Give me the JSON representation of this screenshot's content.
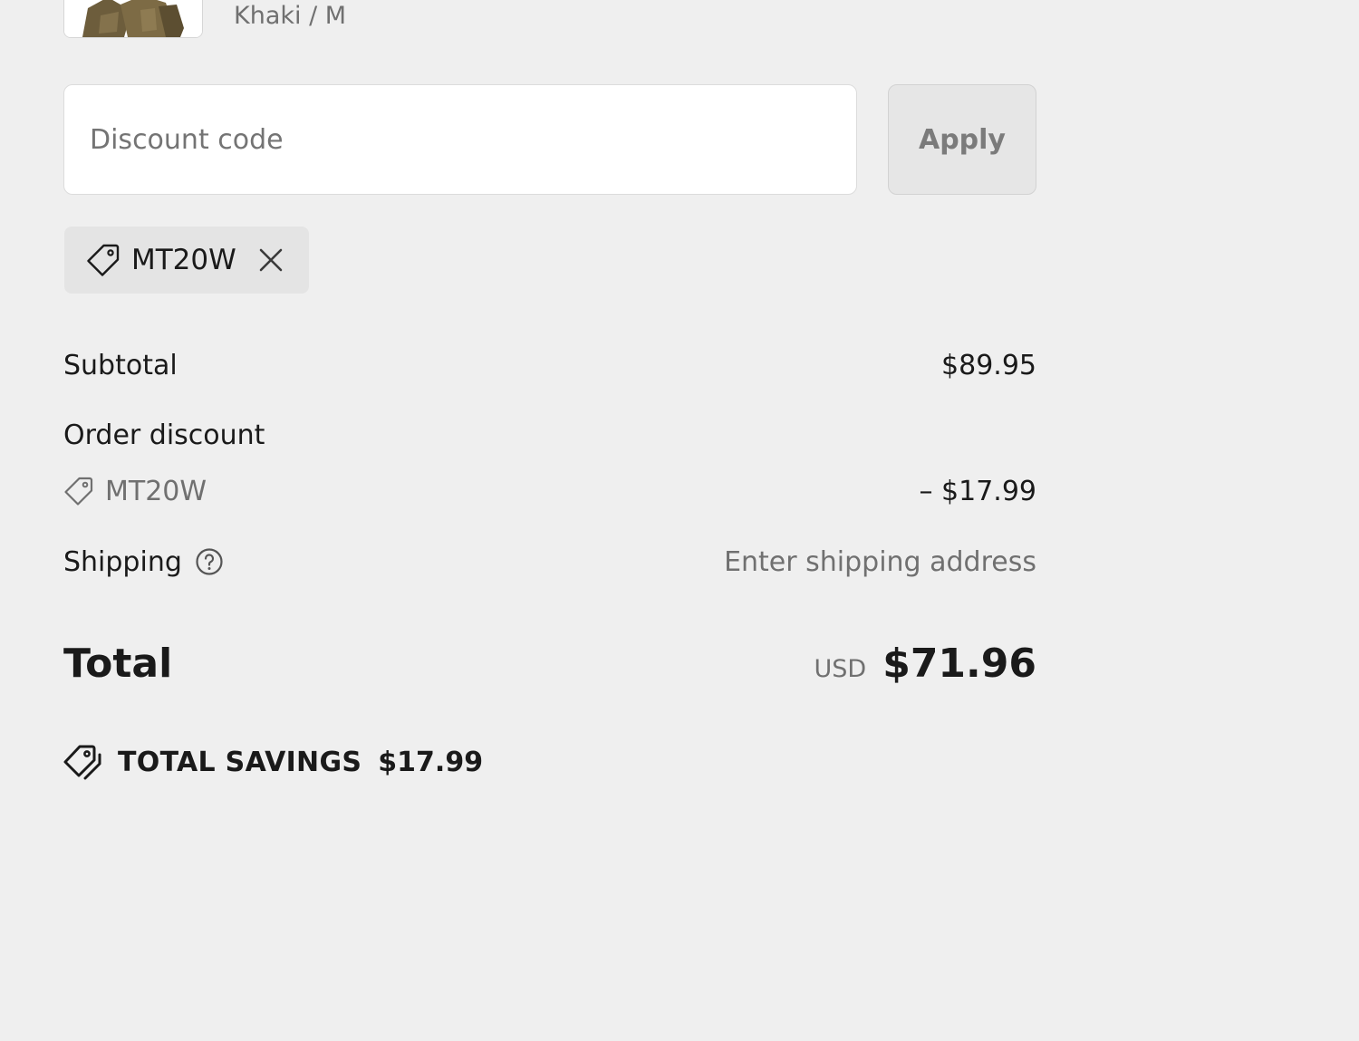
{
  "line_item": {
    "variant": "Khaki / M"
  },
  "discount": {
    "placeholder": "Discount code",
    "apply_label": "Apply",
    "applied_code": "MT20W"
  },
  "summary": {
    "subtotal_label": "Subtotal",
    "subtotal_value": "$89.95",
    "order_discount_label": "Order discount",
    "order_discount_code": "MT20W",
    "order_discount_value": "– $17.99",
    "shipping_label": "Shipping",
    "shipping_value": "Enter shipping address",
    "total_label": "Total",
    "total_currency": "USD",
    "total_value": "$71.96"
  },
  "savings": {
    "label": "TOTAL SAVINGS",
    "value": "$17.99"
  },
  "icons": {
    "tag": "tag-icon",
    "close": "close-icon",
    "help": "help-circle-icon",
    "savings": "savings-tag-icon"
  }
}
